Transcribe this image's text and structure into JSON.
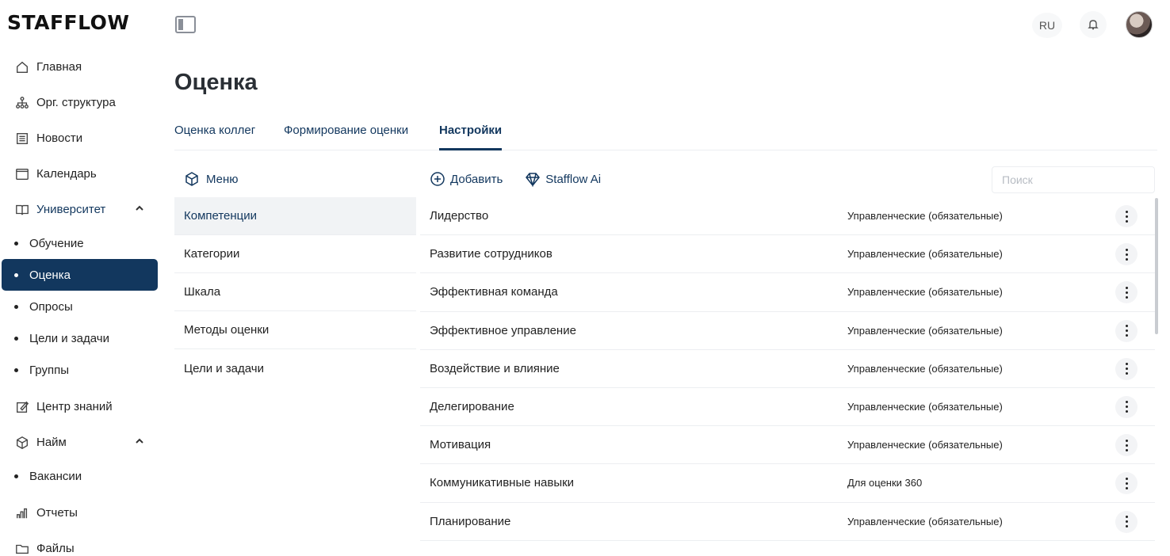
{
  "app": {
    "logo": "STAFFLOW"
  },
  "sidebar": {
    "items": [
      {
        "label": "Главная",
        "icon": "home-icon"
      },
      {
        "label": "Орг. структура",
        "icon": "org-chart-icon"
      },
      {
        "label": "Новости",
        "icon": "newspaper-icon"
      },
      {
        "label": "Календарь",
        "icon": "calendar-icon"
      },
      {
        "label": "Университет",
        "icon": "book-icon",
        "expanded": true,
        "children": [
          "Обучение",
          "Оценка",
          "Опросы",
          "Цели и задачи",
          "Группы"
        ],
        "active_child": "Оценка"
      },
      {
        "label": "Центр знаний",
        "icon": "edit-icon"
      },
      {
        "label": "Найм",
        "icon": "box-icon",
        "expanded": true,
        "children": [
          "Вакансии"
        ]
      },
      {
        "label": "Отчеты",
        "icon": "bar-chart-icon"
      },
      {
        "label": "Файлы",
        "icon": "folder-icon"
      }
    ]
  },
  "header": {
    "lang": "RU",
    "bell_icon": "bell-icon",
    "avatar": "user-avatar"
  },
  "page": {
    "title": "Оценка"
  },
  "tabs": [
    {
      "label": "Оценка коллег",
      "active": false
    },
    {
      "label": "Формирование оценки",
      "active": false
    },
    {
      "label": "Настройки",
      "active": true
    }
  ],
  "settings_menu": {
    "head_label": "Меню",
    "items": [
      "Компетенции",
      "Категории",
      "Шкала",
      "Методы оценки",
      "Цели и задачи"
    ],
    "active": "Компетенции"
  },
  "toolbar": {
    "add_label": "Добавить",
    "ai_label": "Stafflow Ai",
    "search_placeholder": "Поиск"
  },
  "competencies": [
    {
      "name": "Лидерство",
      "category": "Управленческие (обязательные)"
    },
    {
      "name": "Развитие сотрудников",
      "category": "Управленческие (обязательные)"
    },
    {
      "name": "Эффективная команда",
      "category": "Управленческие (обязательные)"
    },
    {
      "name": "Эффективное управление",
      "category": "Управленческие (обязательные)"
    },
    {
      "name": "Воздействие и влияние",
      "category": "Управленческие (обязательные)"
    },
    {
      "name": "Делегирование",
      "category": "Управленческие (обязательные)"
    },
    {
      "name": "Мотивация",
      "category": "Управленческие (обязательные)"
    },
    {
      "name": "Коммуникативные навыки",
      "category": "Для оценки 360"
    },
    {
      "name": "Планирование",
      "category": "Управленческие (обязательные)"
    }
  ],
  "colors": {
    "accent": "#12375e",
    "active_nav_bg": "#12375e",
    "divider": "#eceef1"
  }
}
